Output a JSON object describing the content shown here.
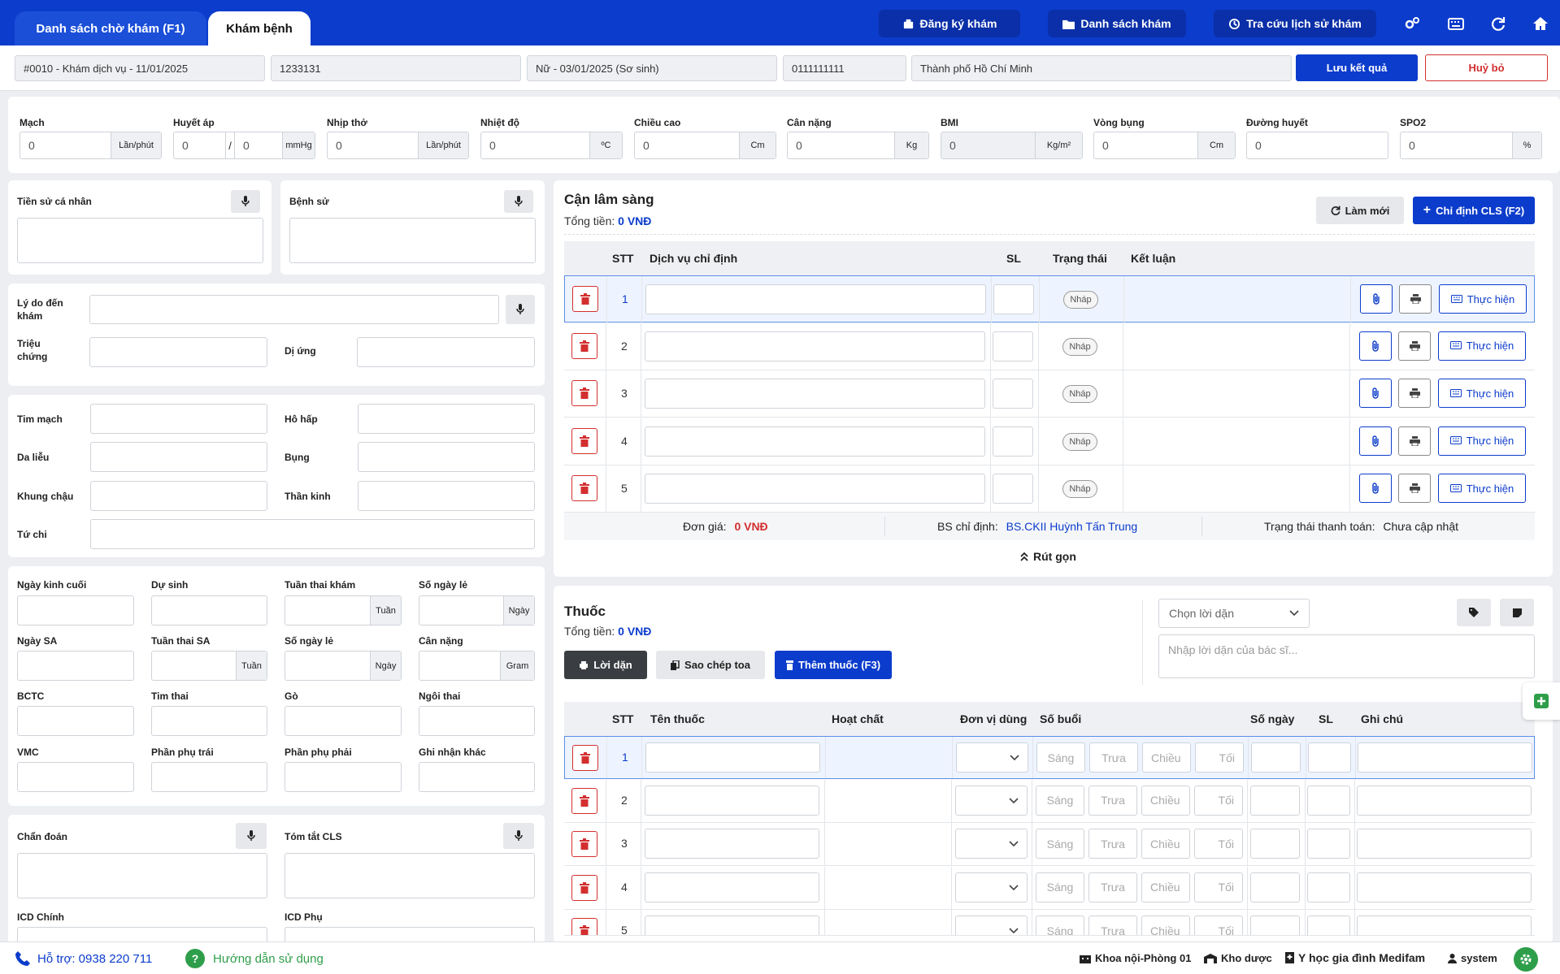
{
  "tabs": [
    {
      "label": "Danh sách chờ khám (F1)"
    },
    {
      "label": "Khám bệnh"
    }
  ],
  "header_actions": {
    "register": "Đăng ký khám",
    "list": "Danh sách khám",
    "history": "Tra cứu lịch sử khám"
  },
  "patient": {
    "visit": "#0010 - Khám dịch vụ - 11/01/2025",
    "code": "1233131",
    "gender_dob": "Nữ - 03/01/2025 (Sơ sinh)",
    "phone": "0111111111",
    "address": "Thành phố Hồ Chí Minh",
    "save": "Lưu kết quả",
    "cancel": "Huỷ bỏ"
  },
  "vitals": [
    {
      "label": "Mạch",
      "value": "0",
      "unit": "Lần/phút"
    },
    {
      "label": "Huyết áp",
      "value": "0",
      "value2": "0",
      "sep": "/",
      "unit": "mmHg"
    },
    {
      "label": "Nhịp thở",
      "value": "0",
      "unit": "Lần/phút"
    },
    {
      "label": "Nhiệt độ",
      "value": "0",
      "unit": "ºC"
    },
    {
      "label": "Chiều cao",
      "value": "0",
      "unit": "Cm"
    },
    {
      "label": "Cân nặng",
      "value": "0",
      "unit": "Kg"
    },
    {
      "label": "BMI",
      "value": "0",
      "unit": "Kg/m²"
    },
    {
      "label": "Vòng bụng",
      "value": "0",
      "unit": "Cm"
    },
    {
      "label": "Đường huyết",
      "value": "0",
      "unit": ""
    },
    {
      "label": "SPO2",
      "value": "0",
      "unit": "%"
    }
  ],
  "history": {
    "personal": "Tiền sử cá nhân",
    "medical": "Bệnh sử"
  },
  "reason": {
    "label": "Lý do đến khám",
    "symptoms": "Triệu chứng",
    "allergy": "Dị ứng"
  },
  "exam": {
    "cardio": "Tim mạch",
    "resp": "Hô hấp",
    "derm": "Da liễu",
    "abd": "Bụng",
    "pelvis": "Khung chậu",
    "neuro": "Thần kinh",
    "limbs": "Tứ chi"
  },
  "obstetric": {
    "lmp": "Ngày kinh cuối",
    "edd": "Dự sinh",
    "ga": "Tuần thai khám",
    "odd_days": "Số ngày lẻ",
    "us_date": "Ngày SA",
    "ga_us": "Tuần thai SA",
    "odd_days2": "Số ngày lẻ",
    "weight": "Cân nặng",
    "bctc": "BCTC",
    "fhr": "Tim thai",
    "go": "Gò",
    "presentation": "Ngôi thai",
    "vmc": "VMC",
    "left_adnexa": "Phần phụ trái",
    "right_adnexa": "Phần phụ phải",
    "other": "Ghi nhận khác",
    "unit_week": "Tuần",
    "unit_day": "Ngày",
    "unit_gram": "Gram"
  },
  "diagnosis": {
    "dx": "Chẩn đoán",
    "cls_summary": "Tóm tắt CLS",
    "icd_main": "ICD Chính",
    "icd_sub": "ICD Phụ"
  },
  "cls": {
    "title": "Cận lâm sàng",
    "total_label": "Tổng tiền:",
    "total": "0 VNĐ",
    "refresh": "Làm mới",
    "order": "Chỉ định CLS (F2)",
    "columns": [
      "STT",
      "Dịch vụ chỉ định",
      "SL",
      "Trạng thái",
      "Kết luận"
    ],
    "rows": [
      {
        "stt": "1",
        "status": "Nháp"
      },
      {
        "stt": "2",
        "status": "Nháp"
      },
      {
        "stt": "3",
        "status": "Nháp"
      },
      {
        "stt": "4",
        "status": "Nháp"
      },
      {
        "stt": "5",
        "status": "Nháp"
      }
    ],
    "do_label": "Thực hiện",
    "unit_price_label": "Đơn giá:",
    "unit_price": "0 VNĐ",
    "doctor_label": "BS chỉ định:",
    "doctor": "BS.CKII Huỳnh Tấn Trung",
    "payment_label": "Trạng thái thanh toán:",
    "payment": "Chưa cập nhật",
    "collapse": "Rút gọn"
  },
  "drug": {
    "title": "Thuốc",
    "total_label": "Tổng tiền:",
    "total": "0 VNĐ",
    "advice": "Lời dặn",
    "copy": "Sao chép toa",
    "add": "Thêm thuốc (F3)",
    "advice_select": "Chọn lời dặn",
    "advice_placeholder": "Nhập lời dặn của bác sĩ...",
    "columns": [
      "STT",
      "Tên thuốc",
      "Hoạt chất",
      "Đơn vị dùng",
      "Số buổi",
      "Số ngày",
      "SL",
      "Ghi chú"
    ],
    "rows": [
      {
        "stt": "1"
      },
      {
        "stt": "2"
      },
      {
        "stt": "3"
      },
      {
        "stt": "4"
      },
      {
        "stt": "5"
      }
    ],
    "sessions": [
      "Sáng",
      "Trưa",
      "Chiều",
      "Tối"
    ]
  },
  "footer": {
    "support": "Hỗ trợ: 0938 220 711",
    "guide": "Hướng dẫn sử dụng",
    "room": "Khoa nội-Phòng 01",
    "pharmacy": "Kho dược",
    "clinic": "Y học gia đình Medifam",
    "user": "system"
  },
  "colors": {
    "primary": "#0c3ccc",
    "danger": "#d32f2f",
    "success": "#2e9e4a"
  }
}
